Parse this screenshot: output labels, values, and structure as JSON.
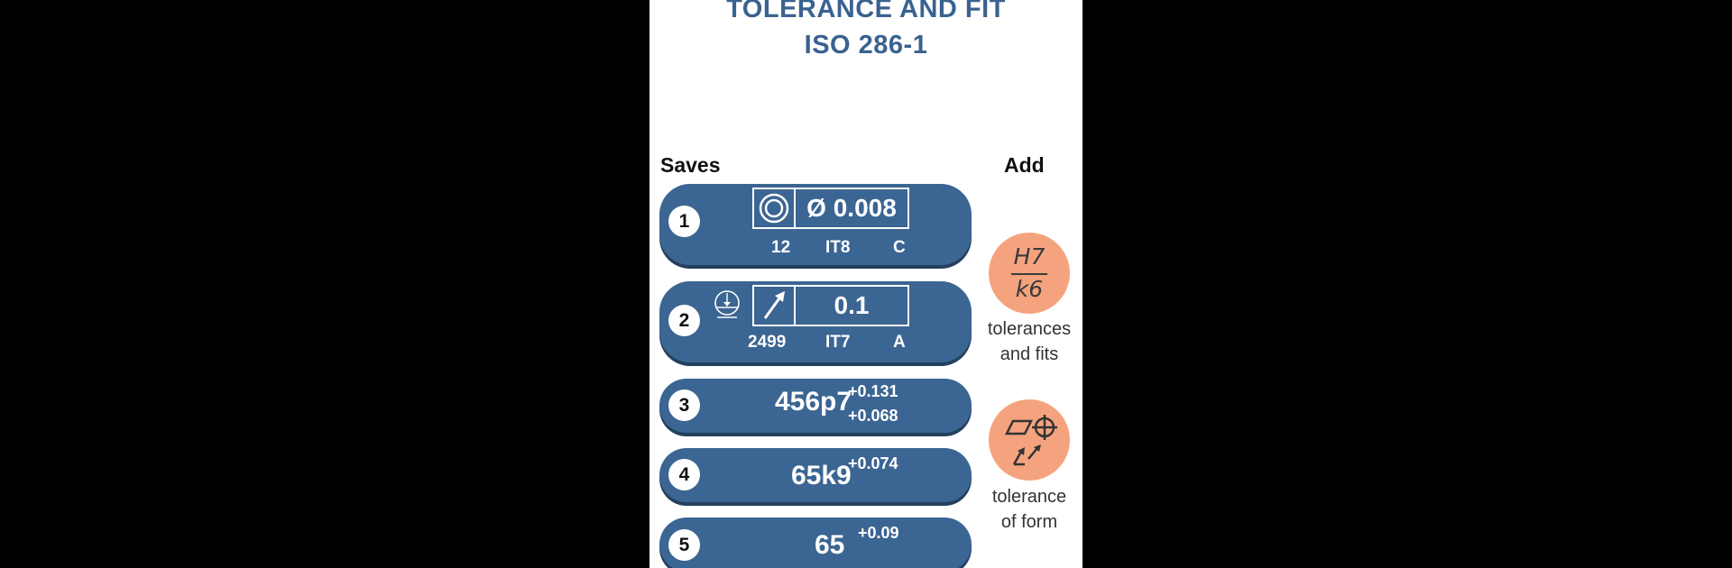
{
  "header": {
    "title_line1": "TOLERANCE AND FIT",
    "title_line2": "ISO 286-1"
  },
  "saves_label": "Saves",
  "add_label": "Add",
  "saves": [
    {
      "number": "1",
      "symbol": "concentricity-icon",
      "value": "Ø 0.008",
      "size": "12",
      "grade": "IT8",
      "class": "C"
    },
    {
      "number": "2",
      "symbol": "total-runout-icon",
      "datum": "datum-feature-icon",
      "value": "0.1",
      "size": "2499",
      "grade": "IT7",
      "class": "A"
    },
    {
      "number": "3",
      "fit": "456p7",
      "upper": "+0.131",
      "lower": "+0.068"
    },
    {
      "number": "4",
      "fit": "65k9",
      "upper": "+0.074"
    },
    {
      "number": "5",
      "fit": "65",
      "upper": "+0.09"
    }
  ],
  "add_buttons": [
    {
      "icon_top": "H7",
      "icon_bottom": "k6",
      "caption_line1": "tolerances",
      "caption_line2": "and fits"
    },
    {
      "icon": "flatness-position-runout-icon",
      "caption_line1": "tolerance",
      "caption_line2": "of form"
    }
  ],
  "colors": {
    "card": "#3b6592",
    "title": "#3a6290",
    "accent": "#f5a37e"
  }
}
